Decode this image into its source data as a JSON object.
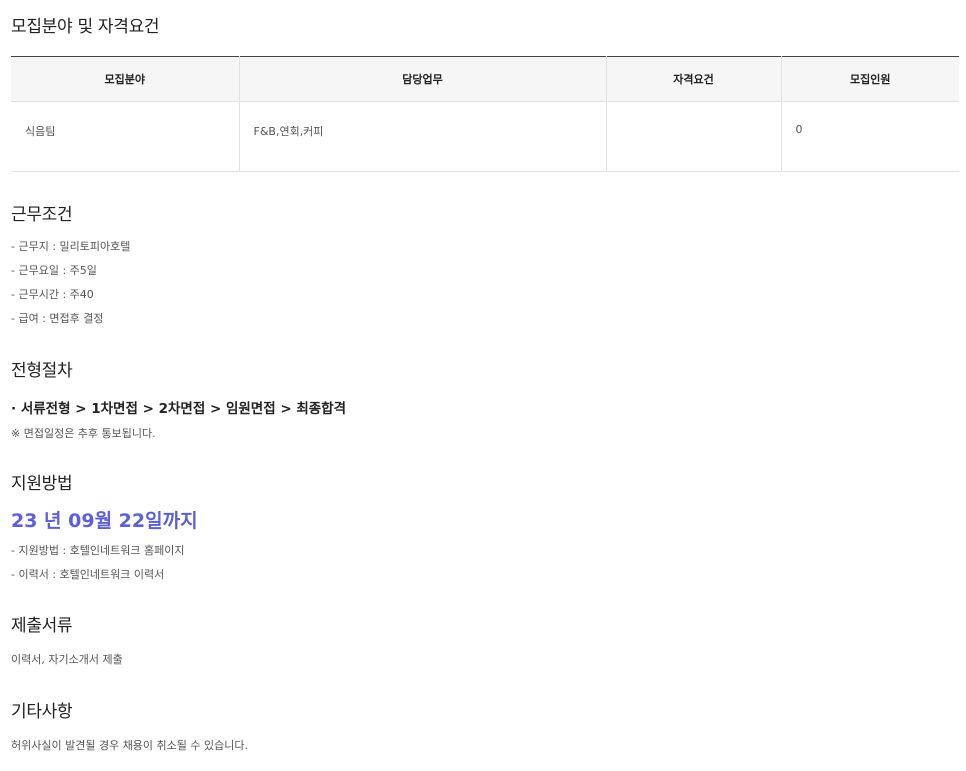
{
  "sections": {
    "recruit_title": "모집분야 및 자격요건",
    "conditions_title": "근무조건",
    "process_title": "전형절차",
    "apply_title": "지원방법",
    "documents_title": "제출서류",
    "other_title": "기타사항"
  },
  "table": {
    "headers": [
      "모집분야",
      "담당업무",
      "자격요건",
      "모집인원"
    ],
    "rows": [
      [
        "식음팀",
        "F&B,연회,커피",
        "",
        "0"
      ]
    ]
  },
  "conditions": [
    "- 근무지 : 밀리토피아호텔",
    "- 근무요일 : 주5일",
    "- 근무시간 : 주40",
    "- 급여 :  면접후 결정"
  ],
  "process": {
    "steps": "· 서류전형 > 1차면접 > 2차면접 > 임원면접 > 최종합격",
    "note": "※ 면접일정은 추후 통보됩니다."
  },
  "apply": {
    "deadline": "23 년 09월 22일까지",
    "lines": [
      "- 지원방법 :  호텔인네트워크 홈페이지",
      "- 이력서 : 호텔인네트워크 이력서"
    ]
  },
  "documents": "이력서, 자기소개서 제출",
  "other": "허위사실이 발견될 경우 채용이 취소될 수 있습니다."
}
